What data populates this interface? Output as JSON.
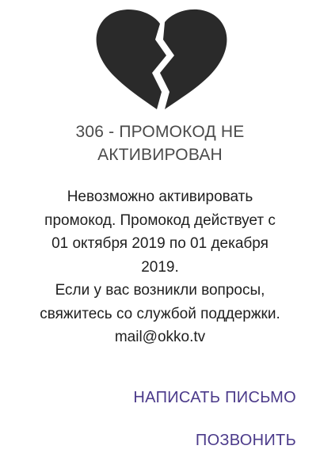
{
  "error": {
    "title_line1": "306 - ПРОМОКОД НЕ",
    "title_line2": "АКТИВИРОВАН",
    "icon": "broken-heart-icon"
  },
  "message": {
    "line1": "Невозможно активировать",
    "line2": "промокод. Промокод действует с",
    "line3": "01 октября 2019 по 01 декабря",
    "line4": "2019.",
    "line5": "Если у вас возникли вопросы,",
    "line6": "свяжитесь со службой поддержки.",
    "line7": "mail@okko.tv"
  },
  "actions": {
    "write_label": "НАПИСАТЬ ПИСЬМО",
    "call_label": "ПОЗВОНИТЬ"
  },
  "colors": {
    "icon": "#2a2a2a",
    "accent": "#4b3a8a",
    "title": "#4a4a4a",
    "text": "#1f1f1f",
    "background": "#ffffff"
  }
}
